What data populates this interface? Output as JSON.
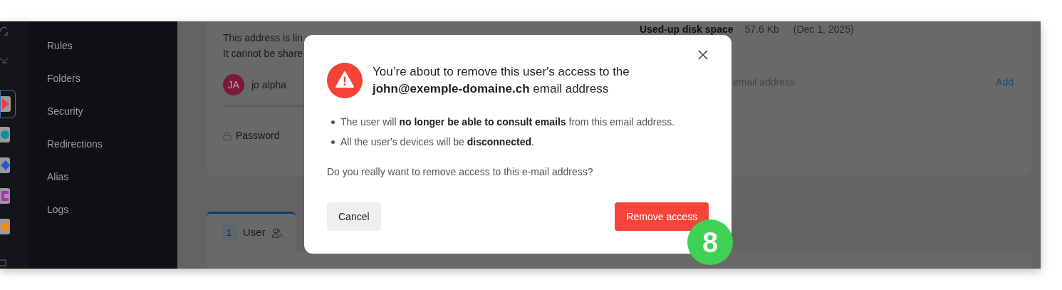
{
  "app_rail": [
    {
      "color": "#e8413a",
      "selected": true
    },
    {
      "color": "#0f8fa0",
      "selected": false
    },
    {
      "color": "#2455d6",
      "selected": false
    },
    {
      "color": "#b326c9",
      "selected": false
    },
    {
      "color": "#f08a1c",
      "selected": false
    }
  ],
  "sidebar": {
    "items": [
      {
        "label": "Rules"
      },
      {
        "label": "Folders"
      },
      {
        "label": "Security"
      },
      {
        "label": "Redirections"
      },
      {
        "label": "Alias"
      },
      {
        "label": "Logs"
      }
    ]
  },
  "account_card": {
    "notice_lines": [
      "This address is lin",
      "It cannot be share"
    ],
    "user": {
      "initials": "JA",
      "name": "jo alpha"
    },
    "password_label": "Password",
    "disk_space": {
      "label": "Used-up disk space",
      "value": "57.6 Kb",
      "date": "(Dec 1, 2025)"
    },
    "email_field": {
      "placeholder": "email address"
    },
    "add_link": "Add"
  },
  "tabs": [
    {
      "count": "1",
      "label": "User",
      "selected": true
    }
  ],
  "dialog": {
    "title": "You’re about to remove this user's access to the **john@exemple-domaine.ch** email address",
    "bullets": [
      "The user will **no longer be able to consult emails** from this email address.",
      "All the user's devices will be **disconnected**."
    ],
    "question": "Do you really want to remove access to this e-mail address?",
    "cancel": "Cancel",
    "confirm": "Remove access"
  },
  "step_badge": "8"
}
